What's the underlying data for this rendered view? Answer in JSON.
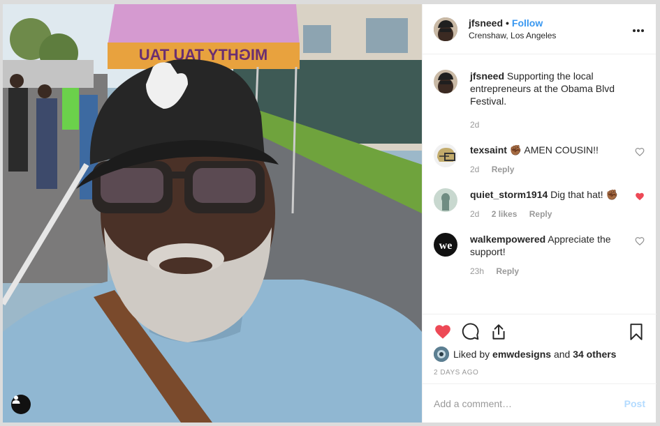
{
  "post": {
    "username": "jfsneed",
    "follow_separator": "•",
    "follow_label": "Follow",
    "location": "Crenshaw, Los Angeles",
    "more_icon": "more-horizontal-icon",
    "photo": {
      "tent_text": "MIGHTY TAU TAU",
      "user_tag_icon": "user-tag-icon"
    }
  },
  "comments": [
    {
      "username": "jfsneed",
      "text": "Supporting the local entrepreneurs at the Obama Blvd Festival.",
      "time": "2d",
      "is_caption": true
    },
    {
      "username": "texsaint",
      "text": "✊🏾 AMEN COUSIN!!",
      "time": "2d",
      "reply_label": "Reply",
      "liked": false
    },
    {
      "username": "quiet_storm1914",
      "text": "Dig that hat! ✊🏾",
      "time": "2d",
      "likes": "2 likes",
      "reply_label": "Reply",
      "liked": true
    },
    {
      "username": "walkempowered",
      "text": "Appreciate the support!",
      "time": "23h",
      "reply_label": "Reply",
      "liked": false
    }
  ],
  "actions": {
    "liked": true,
    "icons": [
      "heart-icon",
      "comment-icon",
      "share-icon",
      "bookmark-icon"
    ]
  },
  "likes": {
    "prefix": "Liked by",
    "user": "emwdesigns",
    "conjunction": "and",
    "others": "34 others"
  },
  "date": "2 DAYS AGO",
  "add_comment": {
    "placeholder": "Add a comment…",
    "post_label": "Post"
  },
  "colors": {
    "accent": "#3897f0",
    "like_red": "#ed4956",
    "post_disabled": "#b3dbff"
  }
}
